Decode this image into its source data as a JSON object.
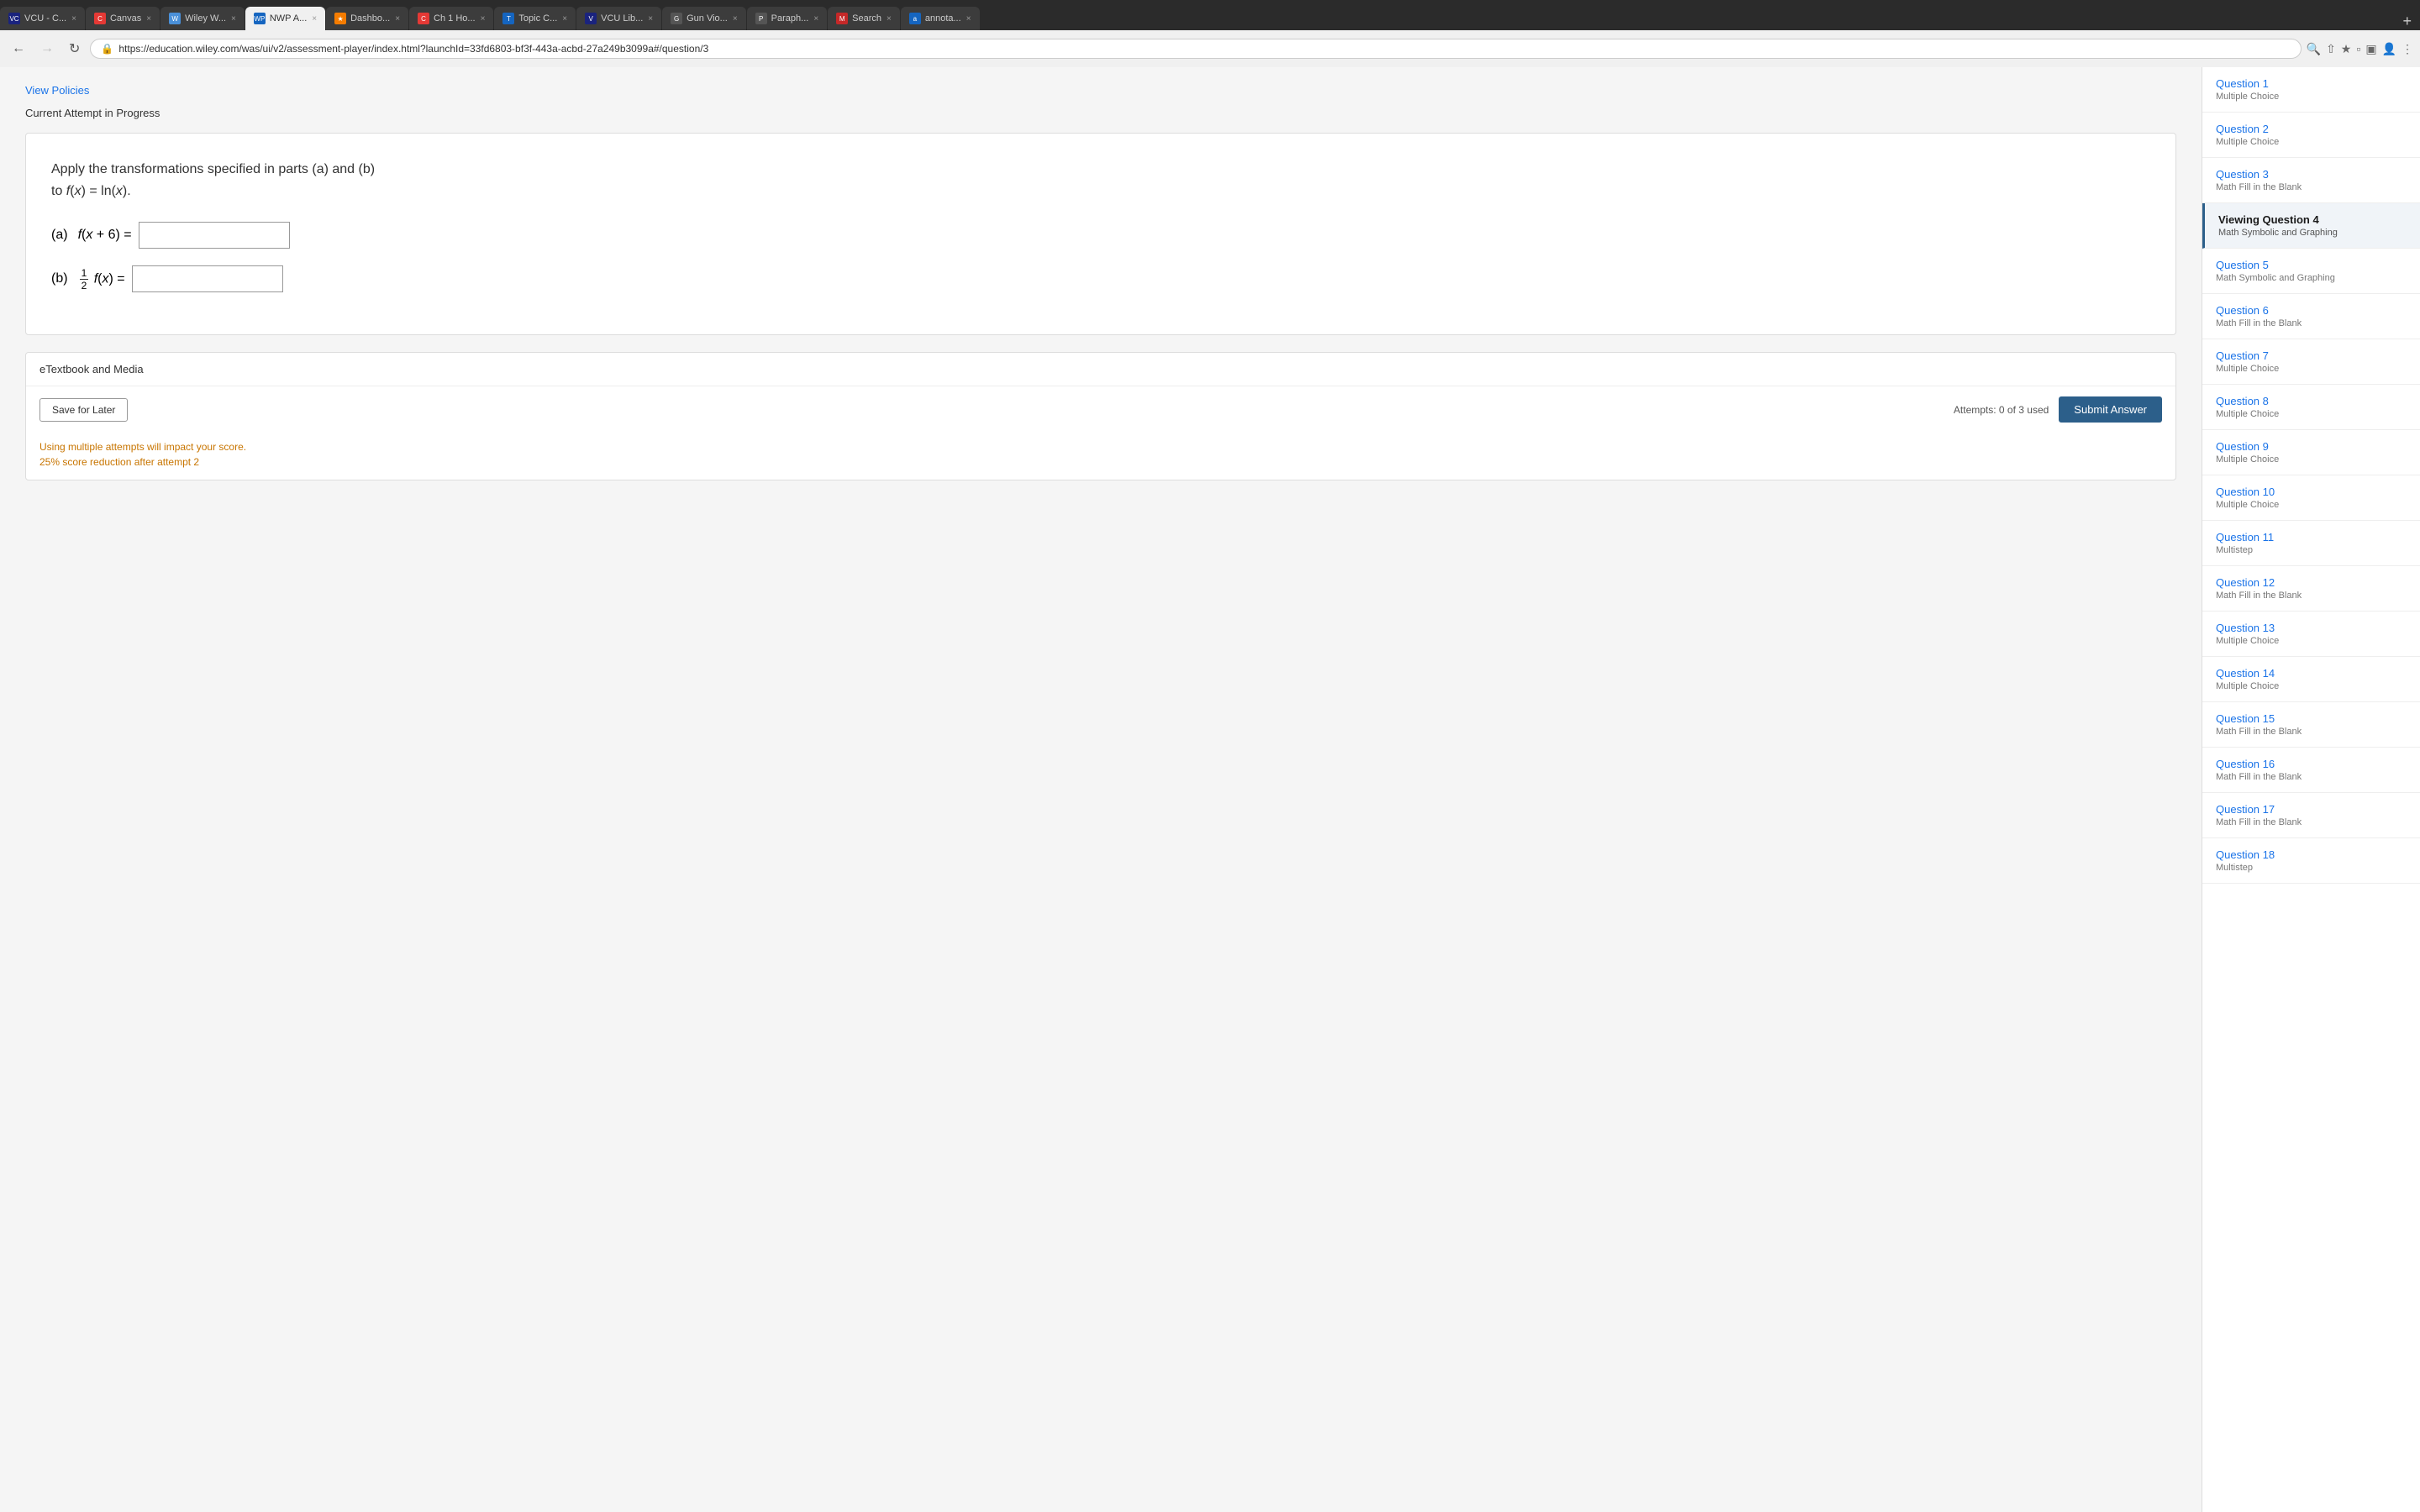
{
  "browser": {
    "tabs": [
      {
        "id": "vcu",
        "label": "VCU - C...",
        "icon_color": "#1a237e",
        "icon_text": "VCU",
        "active": false
      },
      {
        "id": "canvas",
        "label": "Canvas",
        "icon_color": "#e53935",
        "icon_text": "C",
        "active": false
      },
      {
        "id": "wiley",
        "label": "Wiley W...",
        "icon_color": "#4a90d9",
        "icon_text": "W",
        "active": false
      },
      {
        "id": "nwp",
        "label": "NWP A...",
        "icon_color": "#1565c0",
        "icon_text": "WP",
        "active": true
      },
      {
        "id": "dashb",
        "label": "Dashbo...",
        "icon_color": "#f57c00",
        "icon_text": "★",
        "active": false
      },
      {
        "id": "ch1",
        "label": "Ch 1 Ho...",
        "icon_color": "#e53935",
        "icon_text": "C",
        "active": false
      },
      {
        "id": "topic",
        "label": "Topic C...",
        "icon_color": "#1565c0",
        "icon_text": "T",
        "active": false
      },
      {
        "id": "vculib",
        "label": "VCU Lib...",
        "icon_color": "#1a237e",
        "icon_text": "V",
        "active": false
      },
      {
        "id": "gunvio",
        "label": "Gun Vio...",
        "icon_color": "#555",
        "icon_text": "G",
        "active": false
      },
      {
        "id": "paraph",
        "label": "Paraph...",
        "icon_color": "#555",
        "icon_text": "P",
        "active": false
      },
      {
        "id": "search",
        "label": "Search",
        "icon_color": "#c62828",
        "icon_text": "M",
        "active": false
      },
      {
        "id": "annot",
        "label": "annota...",
        "icon_color": "#1565c0",
        "icon_text": "a",
        "active": false
      }
    ],
    "url": "https://education.wiley.com/was/ui/v2/assessment-player/index.html?launchId=33fd6803-bf3f-443a-acbd-27a249b3099a#/question/3"
  },
  "page": {
    "view_policies": "View Policies",
    "current_attempt": "Current Attempt in Progress",
    "question_text_line1": "Apply the transformations specified in parts (a) and (b)",
    "question_text_line2": "to f(x) = ln(x).",
    "part_a_label": "(a)",
    "part_a_expr": "f(x + 6) =",
    "part_b_label": "(b)",
    "part_b_expr_prefix": "f(x) =",
    "etextbook_label": "eTextbook and Media",
    "save_later": "Save for Later",
    "attempts_text": "Attempts: 0 of 3 used",
    "submit_label": "Submit Answer",
    "warning_line1": "Using multiple attempts will impact your score.",
    "warning_line2": "25% score reduction after attempt 2"
  },
  "sidebar": {
    "items": [
      {
        "id": 1,
        "title": "Question 1",
        "subtitle": "Multiple Choice",
        "active": false
      },
      {
        "id": 2,
        "title": "Question 2",
        "subtitle": "Multiple Choice",
        "active": false
      },
      {
        "id": 3,
        "title": "Question 3",
        "subtitle": "Math Fill in the Blank",
        "active": false
      },
      {
        "id": 4,
        "title": "Viewing Question 4",
        "subtitle": "Math Symbolic and Graphing",
        "active": true
      },
      {
        "id": 5,
        "title": "Question 5",
        "subtitle": "Math Symbolic and Graphing",
        "active": false
      },
      {
        "id": 6,
        "title": "Question 6",
        "subtitle": "Math Fill in the Blank",
        "active": false
      },
      {
        "id": 7,
        "title": "Question 7",
        "subtitle": "Multiple Choice",
        "active": false
      },
      {
        "id": 8,
        "title": "Question 8",
        "subtitle": "Multiple Choice",
        "active": false
      },
      {
        "id": 9,
        "title": "Question 9",
        "subtitle": "Multiple Choice",
        "active": false
      },
      {
        "id": 10,
        "title": "Question 10",
        "subtitle": "Multiple Choice",
        "active": false
      },
      {
        "id": 11,
        "title": "Question 11",
        "subtitle": "Multistep",
        "active": false
      },
      {
        "id": 12,
        "title": "Question 12",
        "subtitle": "Math Fill in the Blank",
        "active": false
      },
      {
        "id": 13,
        "title": "Question 13",
        "subtitle": "Multiple Choice",
        "active": false
      },
      {
        "id": 14,
        "title": "Question 14",
        "subtitle": "Multiple Choice",
        "active": false
      },
      {
        "id": 15,
        "title": "Question 15",
        "subtitle": "Math Fill in the Blank",
        "active": false
      },
      {
        "id": 16,
        "title": "Question 16",
        "subtitle": "Math Fill in the Blank",
        "active": false
      },
      {
        "id": 17,
        "title": "Question 17",
        "subtitle": "Math Fill in the Blank",
        "active": false
      },
      {
        "id": 18,
        "title": "Question 18",
        "subtitle": "Multistep",
        "active": false
      }
    ]
  }
}
